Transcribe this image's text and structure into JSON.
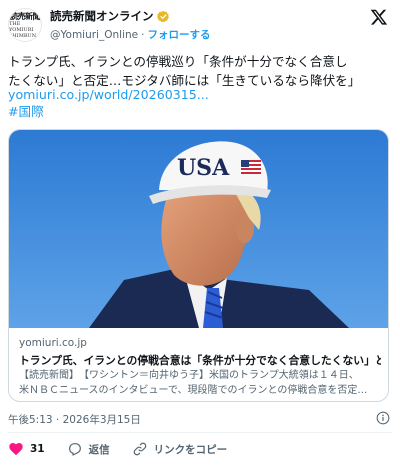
{
  "account": {
    "display_name": "読売新聞オンライン",
    "handle": "@Yomiuri_Online",
    "separator": "·",
    "follow_label": "フォローする",
    "avatar_line1": "読売新聞",
    "avatar_line2": "THE YOMIURI SHIMBUN"
  },
  "tweet": {
    "text": "トランプ氏、イランとの停戦巡り「条件が十分でなく合意し\nたくない」と否定…モジタバ師には「生きているなら降伏を」",
    "link": "yomiuri.co.jp/world/20260315...",
    "hashtag": "#国際"
  },
  "card": {
    "cap_text": "USA",
    "domain": "yomiuri.co.jp",
    "title": "トランプ氏、イランとの停戦合意は「条件が十分でなく合意したくない」と…",
    "desc_line1": "【読売新聞】　【ワシントン＝向井ゆう子】米国のトランプ大統領は１４日、",
    "desc_line2": "米ＮＢＣニュースのインタビューで、現段階でのイランとの停戦合意を否定…"
  },
  "meta": {
    "timestamp": "午後5:13 · 2026年3月15日"
  },
  "actions": {
    "like_count": "31",
    "reply_label": "返信",
    "copy_link_label": "リンクをコピー"
  },
  "colors": {
    "accent": "#1d9bf0",
    "like": "#f91880",
    "secondary_text": "#536471",
    "border": "#cfd9de"
  }
}
